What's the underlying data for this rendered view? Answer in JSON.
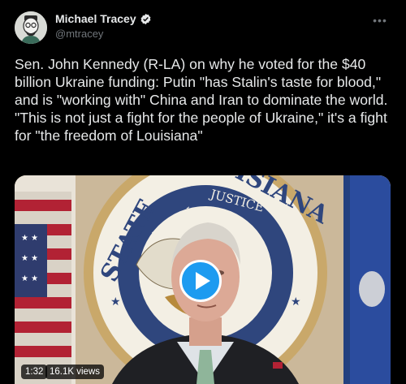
{
  "tweet": {
    "display_name": "Michael Tracey",
    "handle": "@mtracey",
    "verified": true,
    "more_icon": "more-horizontal-icon",
    "text": "Sen. John Kennedy (R-LA) on why he voted for the $40 billion Ukraine funding: Putin \"has Stalin's taste for blood,\" and is \"working with\" China and Iran to dominate the world. \"This is not just a fight for the people of Ukraine,\" it's a fight for \"the freedom of Louisiana\"",
    "accent_color": "#1d9bf0"
  },
  "video": {
    "duration": "1:32",
    "views": "16.1K views",
    "play_icon": "play-icon",
    "seal_text_top": "STATE OF LOUISIANA",
    "seal_text_inner": "UNION  JUSTICE"
  }
}
